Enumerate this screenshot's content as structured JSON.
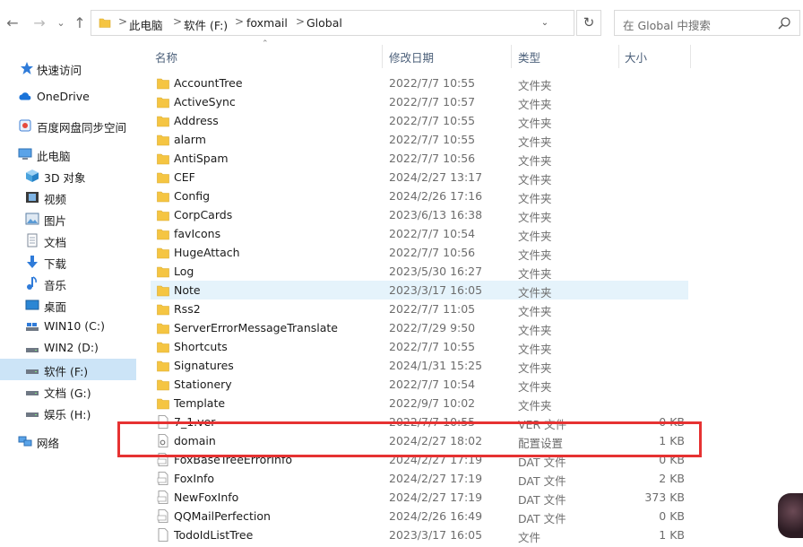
{
  "nav": {
    "back_icon": "←",
    "forward_icon": "→",
    "recent_icon": "⌄",
    "up_icon": "↑"
  },
  "address": {
    "crumbs": [
      "此电脑",
      "软件 (F:)",
      "foxmail",
      "Global"
    ],
    "separator": ">"
  },
  "search": {
    "placeholder": "在 Global 中搜索"
  },
  "sidebar": {
    "items": [
      {
        "label": "快速访问",
        "icon": "star-icon"
      },
      {
        "label": "OneDrive",
        "icon": "cloud-icon"
      },
      {
        "label": "百度网盘同步空间",
        "icon": "baidu-netdisk-icon"
      },
      {
        "label": "此电脑",
        "icon": "computer-icon"
      },
      {
        "label": "3D 对象",
        "icon": "cube-icon"
      },
      {
        "label": "视频",
        "icon": "video-icon"
      },
      {
        "label": "图片",
        "icon": "picture-icon"
      },
      {
        "label": "文档",
        "icon": "document-icon"
      },
      {
        "label": "下载",
        "icon": "download-icon"
      },
      {
        "label": "音乐",
        "icon": "music-icon"
      },
      {
        "label": "桌面",
        "icon": "desktop-icon"
      },
      {
        "label": "WIN10 (C:)",
        "icon": "drive-icon"
      },
      {
        "label": "WIN2 (D:)",
        "icon": "drive-icon"
      },
      {
        "label": "软件 (F:)",
        "icon": "drive-icon"
      },
      {
        "label": "文档 (G:)",
        "icon": "drive-icon"
      },
      {
        "label": "娱乐 (H:)",
        "icon": "drive-icon"
      },
      {
        "label": "网络",
        "icon": "network-icon"
      }
    ]
  },
  "columns": {
    "name": "名称",
    "date": "修改日期",
    "type": "类型",
    "size": "大小"
  },
  "files": [
    {
      "name": "AccountTree",
      "date": "2022/7/7 10:55",
      "type": "文件夹",
      "size": "",
      "kind": "folder"
    },
    {
      "name": "ActiveSync",
      "date": "2022/7/7 10:57",
      "type": "文件夹",
      "size": "",
      "kind": "folder"
    },
    {
      "name": "Address",
      "date": "2022/7/7 10:55",
      "type": "文件夹",
      "size": "",
      "kind": "folder"
    },
    {
      "name": "alarm",
      "date": "2022/7/7 10:55",
      "type": "文件夹",
      "size": "",
      "kind": "folder"
    },
    {
      "name": "AntiSpam",
      "date": "2022/7/7 10:56",
      "type": "文件夹",
      "size": "",
      "kind": "folder"
    },
    {
      "name": "CEF",
      "date": "2024/2/27 13:17",
      "type": "文件夹",
      "size": "",
      "kind": "folder"
    },
    {
      "name": "Config",
      "date": "2024/2/26 17:16",
      "type": "文件夹",
      "size": "",
      "kind": "folder"
    },
    {
      "name": "CorpCards",
      "date": "2023/6/13 16:38",
      "type": "文件夹",
      "size": "",
      "kind": "folder"
    },
    {
      "name": "favIcons",
      "date": "2022/7/7 10:54",
      "type": "文件夹",
      "size": "",
      "kind": "folder"
    },
    {
      "name": "HugeAttach",
      "date": "2022/7/7 10:56",
      "type": "文件夹",
      "size": "",
      "kind": "folder"
    },
    {
      "name": "Log",
      "date": "2023/5/30 16:27",
      "type": "文件夹",
      "size": "",
      "kind": "folder"
    },
    {
      "name": "Note",
      "date": "2023/3/17 16:05",
      "type": "文件夹",
      "size": "",
      "kind": "folder"
    },
    {
      "name": "Rss2",
      "date": "2022/7/7 11:05",
      "type": "文件夹",
      "size": "",
      "kind": "folder"
    },
    {
      "name": "ServerErrorMessageTranslate",
      "date": "2022/7/29 9:50",
      "type": "文件夹",
      "size": "",
      "kind": "folder"
    },
    {
      "name": "Shortcuts",
      "date": "2022/7/7 10:55",
      "type": "文件夹",
      "size": "",
      "kind": "folder"
    },
    {
      "name": "Signatures",
      "date": "2024/1/31 15:25",
      "type": "文件夹",
      "size": "",
      "kind": "folder"
    },
    {
      "name": "Stationery",
      "date": "2022/7/7 10:54",
      "type": "文件夹",
      "size": "",
      "kind": "folder"
    },
    {
      "name": "Template",
      "date": "2022/9/7 10:02",
      "type": "文件夹",
      "size": "",
      "kind": "folder"
    },
    {
      "name": "7_1.ver",
      "date": "2022/7/7 10:55",
      "type": "VER 文件",
      "size": "0 KB",
      "kind": "file"
    },
    {
      "name": "domain",
      "date": "2024/2/27 18:02",
      "type": "配置设置",
      "size": "1 KB",
      "kind": "config"
    },
    {
      "name": "FoxBaseTreeErrorInfo",
      "date": "2024/2/27 17:19",
      "type": "DAT 文件",
      "size": "0 KB",
      "kind": "dat"
    },
    {
      "name": "FoxInfo",
      "date": "2024/2/27 17:19",
      "type": "DAT 文件",
      "size": "2 KB",
      "kind": "dat"
    },
    {
      "name": "NewFoxInfo",
      "date": "2024/2/27 17:19",
      "type": "DAT 文件",
      "size": "373 KB",
      "kind": "dat"
    },
    {
      "name": "QQMailPerfection",
      "date": "2024/2/26 16:49",
      "type": "DAT 文件",
      "size": "0 KB",
      "kind": "dat"
    },
    {
      "name": "TodoIdListTree",
      "date": "2023/3/17 16:05",
      "type": "文件",
      "size": "1 KB",
      "kind": "file"
    }
  ],
  "state": {
    "selected_sidebar": "软件 (F:)",
    "hovered_row": "Note",
    "highlighted_row": "domain"
  },
  "colors": {
    "folder": "#f5c542",
    "selection": "#cce4f7",
    "hover": "#e5f3fb",
    "highlight_border": "#e63232"
  }
}
